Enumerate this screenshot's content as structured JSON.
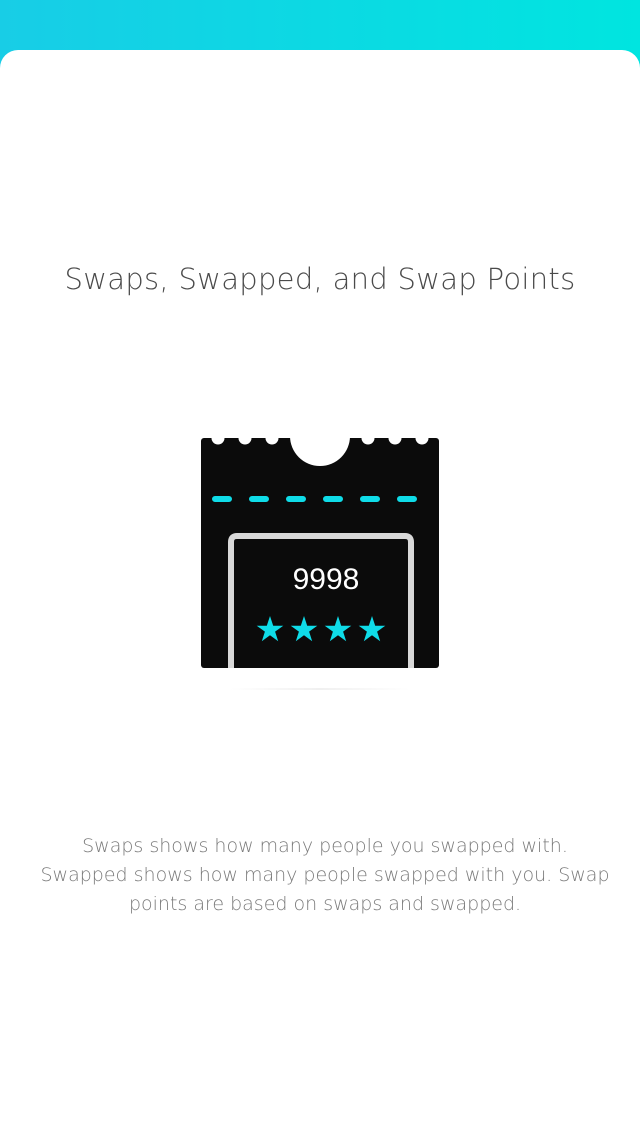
{
  "screen": {
    "accent_color": "#0fdce8",
    "ticket_color": "#0b0b0b",
    "frame_color": "#d9d9d9"
  },
  "title": "Swaps, Swapped, and Swap Points",
  "ticket": {
    "points": "9998",
    "rating": 4,
    "rating_max": 4,
    "star_icon": "star-icon"
  },
  "description": "Swaps shows how many people you swapped with. Swapped shows how many people swapped with you. Swap points are based on swaps and swapped."
}
